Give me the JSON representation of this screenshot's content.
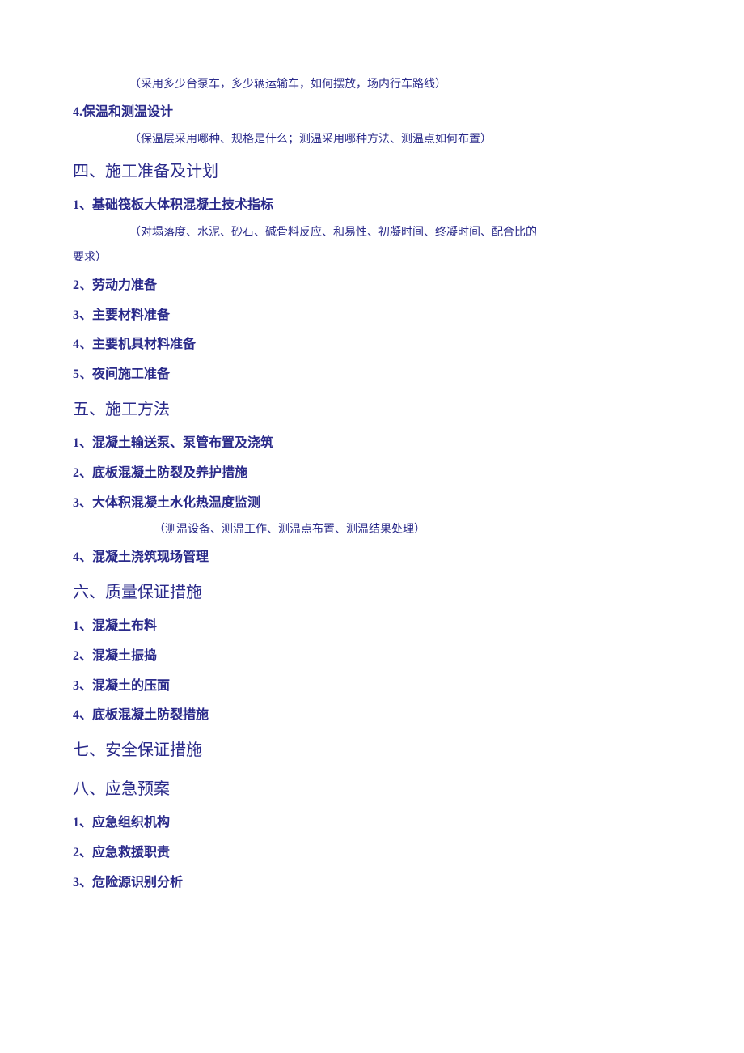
{
  "note1": "（采用多少台泵车，多少辆运输车，如何摆放，场内行车路线）",
  "item4_label": "4.保温和测温设计",
  "note2": "（保温层采用哪种、规格是什么；测温采用哪种方法、测温点如何布置）",
  "sec4_title": "四、施工准备及计划",
  "sec4_item1": "1、基础筏板大体积混凝土技术指标",
  "sec4_note1a": "（对塌落度、水泥、砂石、碱骨料反应、和易性、初凝时间、终凝时间、配合比的",
  "sec4_note1b": "要求）",
  "sec4_item2": "2、劳动力准备",
  "sec4_item3": "3、主要材料准备",
  "sec4_item4": "4、主要机具材料准备",
  "sec4_item5": "5、夜间施工准备",
  "sec5_title": "五、施工方法",
  "sec5_item1": "1、混凝土输送泵、泵管布置及浇筑",
  "sec5_item2": "2、底板混凝土防裂及养护措施",
  "sec5_item3": "3、大体积混凝土水化热温度监测",
  "sec5_note1": "（测温设备、测温工作、测温点布置、测温结果处理）",
  "sec5_item4": "4、混凝土浇筑现场管理",
  "sec6_title": "六、质量保证措施",
  "sec6_item1": "1、混凝土布料",
  "sec6_item2": "2、混凝土振捣",
  "sec6_item3": "3、混凝土的压面",
  "sec6_item4": "4、底板混凝土防裂措施",
  "sec7_title": "七、安全保证措施",
  "sec8_title": "八、应急预案",
  "sec8_item1": "1、应急组织机构",
  "sec8_item2": "2、应急救援职责",
  "sec8_item3": "3、危险源识别分析"
}
